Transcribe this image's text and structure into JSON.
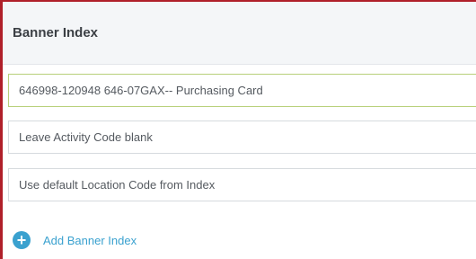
{
  "panel": {
    "title": "Banner Index"
  },
  "fields": {
    "index_value": "646998-120948 646-07GAX-- Purchasing Card",
    "activity_value": "Leave Activity Code blank",
    "location_value": "Use default Location Code from Index"
  },
  "actions": {
    "add_banner_index_label": "Add Banner Index",
    "add_icon": "plus-circle-icon"
  },
  "colors": {
    "accent": "#3aa1cf",
    "active_border": "#b8d07a",
    "frame_border": "#b0202a"
  }
}
